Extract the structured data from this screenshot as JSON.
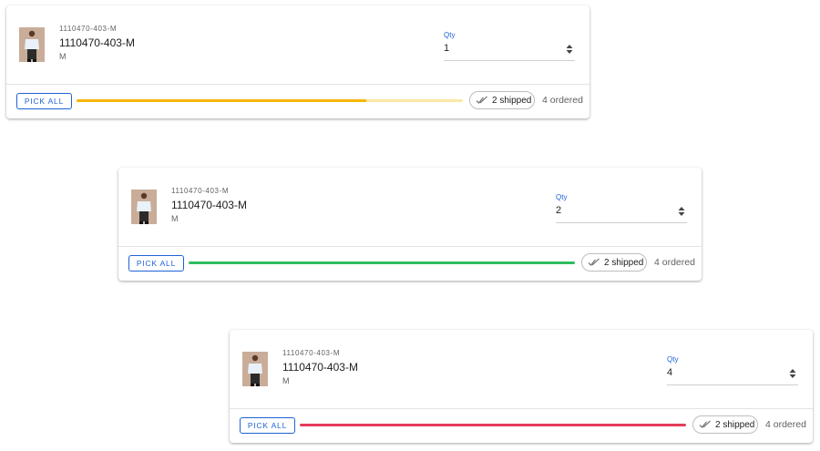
{
  "lines": [
    {
      "sku_small": "1110470-403-M",
      "sku_title": "1110470-403-M",
      "size": "M",
      "qty_label": "Qty",
      "qty_value": "1",
      "pick_label": "PICK ALL",
      "shipped_label": "2 shipped",
      "ordered_label": "4 ordered",
      "progress_fraction": 0.75,
      "progress_color": "#f5b700",
      "progress_track_color": "#fbe8a6"
    },
    {
      "sku_small": "1110470-403-M",
      "sku_title": "1110470-403-M",
      "size": "M",
      "qty_label": "Qty",
      "qty_value": "2",
      "pick_label": "PICK ALL",
      "shipped_label": "2 shipped",
      "ordered_label": "4 ordered",
      "progress_fraction": 1.0,
      "progress_color": "#2ebd5f",
      "progress_track_color": "#bfe9cd"
    },
    {
      "sku_small": "1110470-403-M",
      "sku_title": "1110470-403-M",
      "size": "M",
      "qty_label": "Qty",
      "qty_value": "4",
      "pick_label": "PICK ALL",
      "shipped_label": "2 shipped",
      "ordered_label": "4 ordered",
      "progress_fraction": 1.0,
      "progress_color": "#e53b5a",
      "progress_track_color": "#f6c2cc"
    }
  ],
  "icons": {
    "thumbnail": "product-photo",
    "stepper": "up-down-stepper-icon",
    "shipped": "double-check-icon"
  },
  "colors": {
    "accent": "#1e63d6"
  }
}
